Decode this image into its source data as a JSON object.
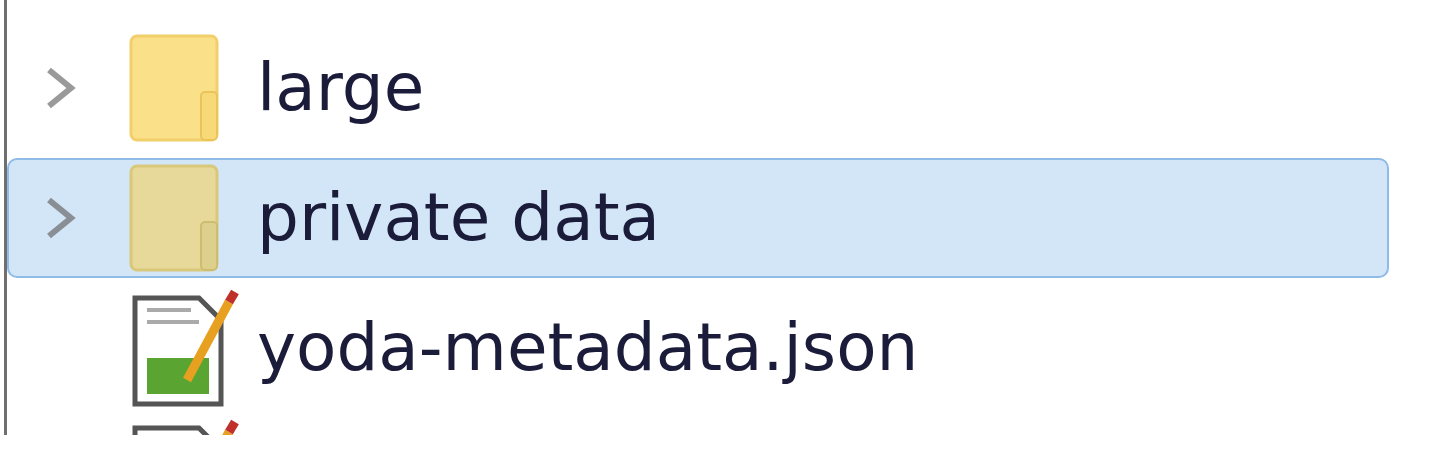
{
  "tree": {
    "items": [
      {
        "kind": "folder",
        "name": "large",
        "expandable": true,
        "selected": false
      },
      {
        "kind": "folder",
        "name": "private data",
        "expandable": true,
        "selected": true
      },
      {
        "kind": "file",
        "name": "yoda-metadata.json",
        "expandable": false,
        "selected": false
      },
      {
        "kind": "file",
        "selected": false
      }
    ]
  }
}
